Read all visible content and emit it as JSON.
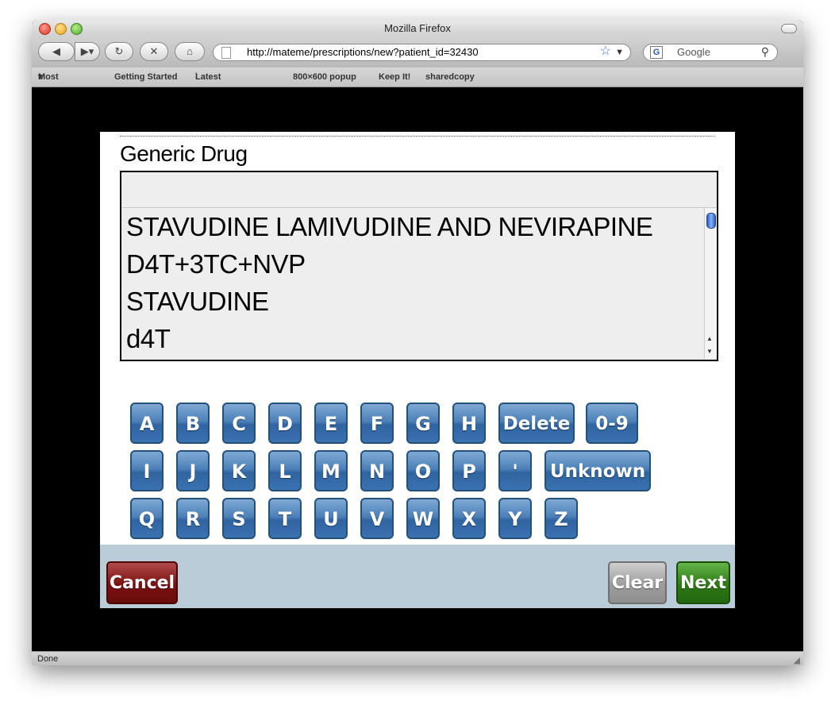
{
  "browser": {
    "title": "Mozilla Firefox",
    "url": "http://mateme/prescriptions/new?patient_id=32430",
    "search_placeholder": "Google",
    "status": "Done"
  },
  "bookmarks": [
    "Most Visited",
    "Getting Started",
    "Latest Headlines",
    "800×600 popup",
    "Keep It!",
    "sharedcopy"
  ],
  "form": {
    "field_label": "Generic Drug",
    "input_value": "",
    "options": [
      "STAVUDINE LAMIVUDINE AND NEVIRAPINE",
      "D4T+3TC+NVP",
      "STAVUDINE",
      "d4T"
    ]
  },
  "keyboard": {
    "row1": [
      "A",
      "B",
      "C",
      "D",
      "E",
      "F",
      "G",
      "H",
      "Delete",
      "0-9"
    ],
    "row2": [
      "I",
      "J",
      "K",
      "L",
      "M",
      "N",
      "O",
      "P",
      "'",
      "Unknown"
    ],
    "row3": [
      "Q",
      "R",
      "S",
      "T",
      "U",
      "V",
      "W",
      "X",
      "Y",
      "Z"
    ]
  },
  "footer": {
    "cancel_label": "Cancel",
    "clear_label": "Clear",
    "next_label": "Next"
  }
}
